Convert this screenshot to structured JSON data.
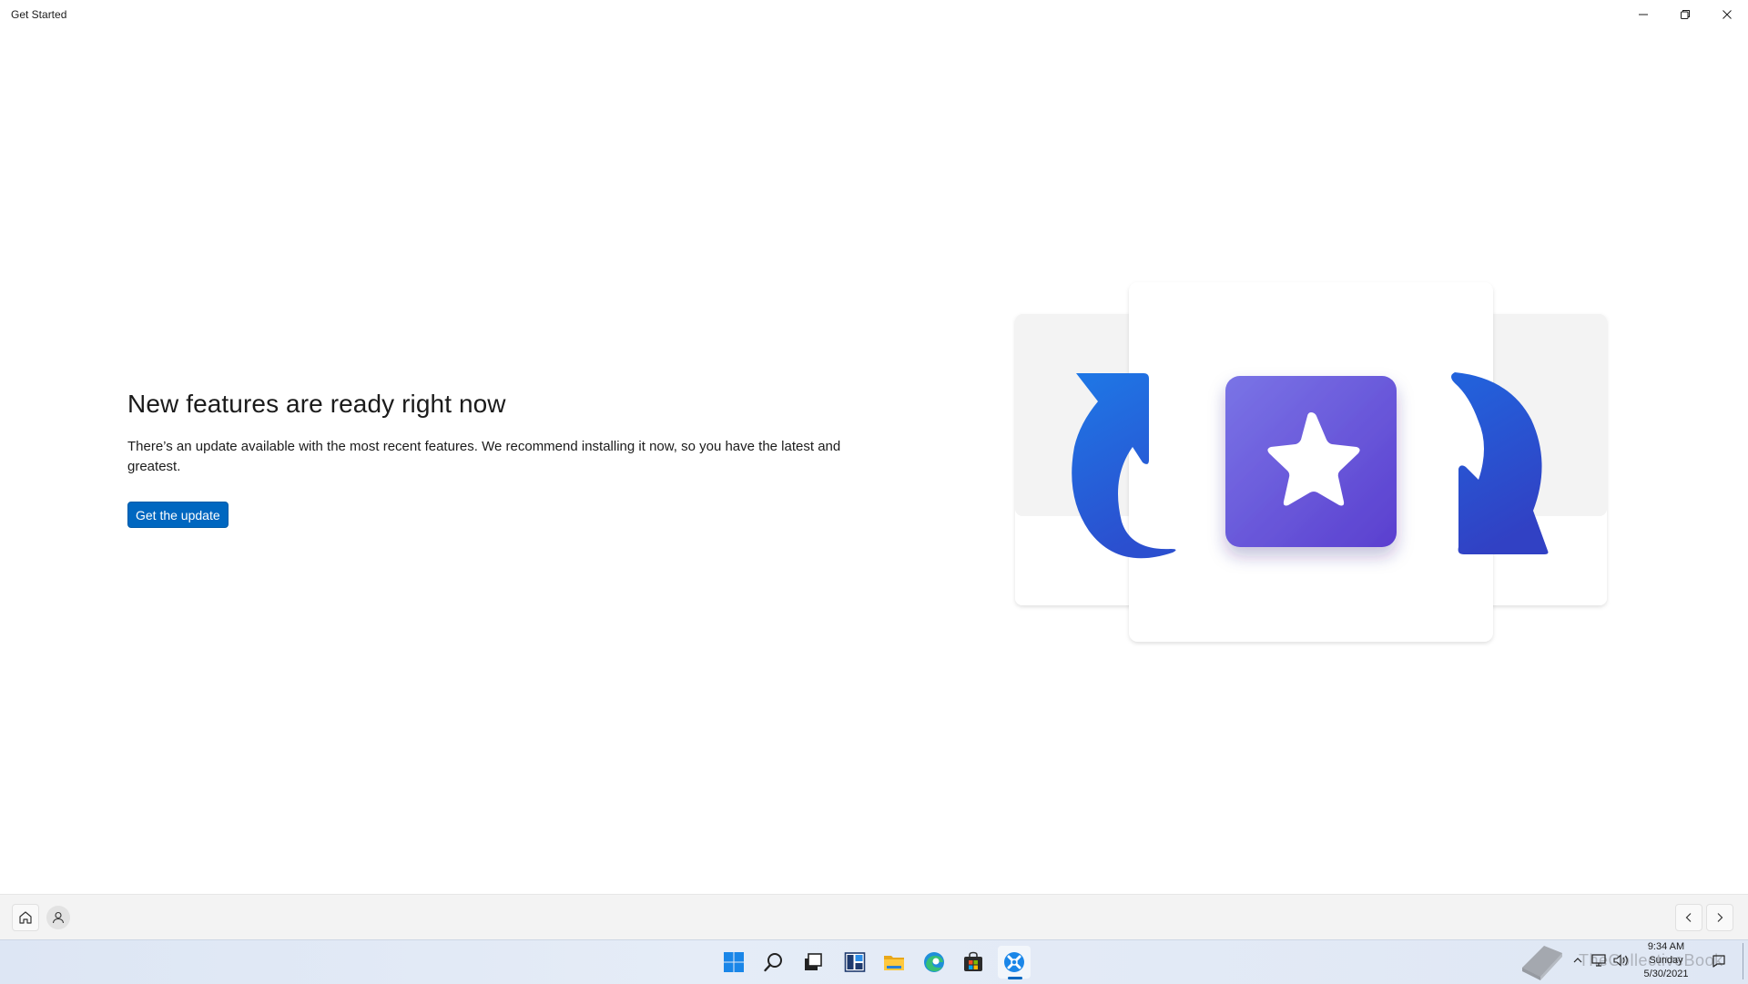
{
  "window": {
    "title": "Get Started",
    "controls": [
      "minimize",
      "restore",
      "close"
    ]
  },
  "content": {
    "headline": "New features are ready right now",
    "description": "There’s an update available with the most recent features. We recommend installing it now, so you have the latest and greatest.",
    "primary_button": "Get the update"
  },
  "illustration": {
    "icons": [
      "refresh-arrow-left-icon",
      "star-tile-icon",
      "refresh-arrow-right-icon"
    ],
    "colors": {
      "arrow": "#2a5cd9",
      "tile": "#6551d6",
      "star": "#ffffff"
    }
  },
  "appbar": {
    "left": [
      "home-icon",
      "profile-icon"
    ],
    "right": [
      "chevron-left-icon",
      "chevron-right-icon"
    ]
  },
  "taskbar": {
    "icons": [
      "start-icon",
      "search-icon",
      "task-view-icon",
      "widgets-icon",
      "file-explorer-icon",
      "edge-icon",
      "store-icon",
      "get-started-icon"
    ],
    "active": "get-started-icon"
  },
  "tray": {
    "time": "9:34 AM",
    "day": "Sunday",
    "date": "5/30/2021",
    "watermark": "TheCollectiveBook"
  },
  "colors": {
    "accent": "#0067c0",
    "background": "#ffffff",
    "appbar": "#f3f3f3",
    "taskbar": "#e2e9f5"
  }
}
